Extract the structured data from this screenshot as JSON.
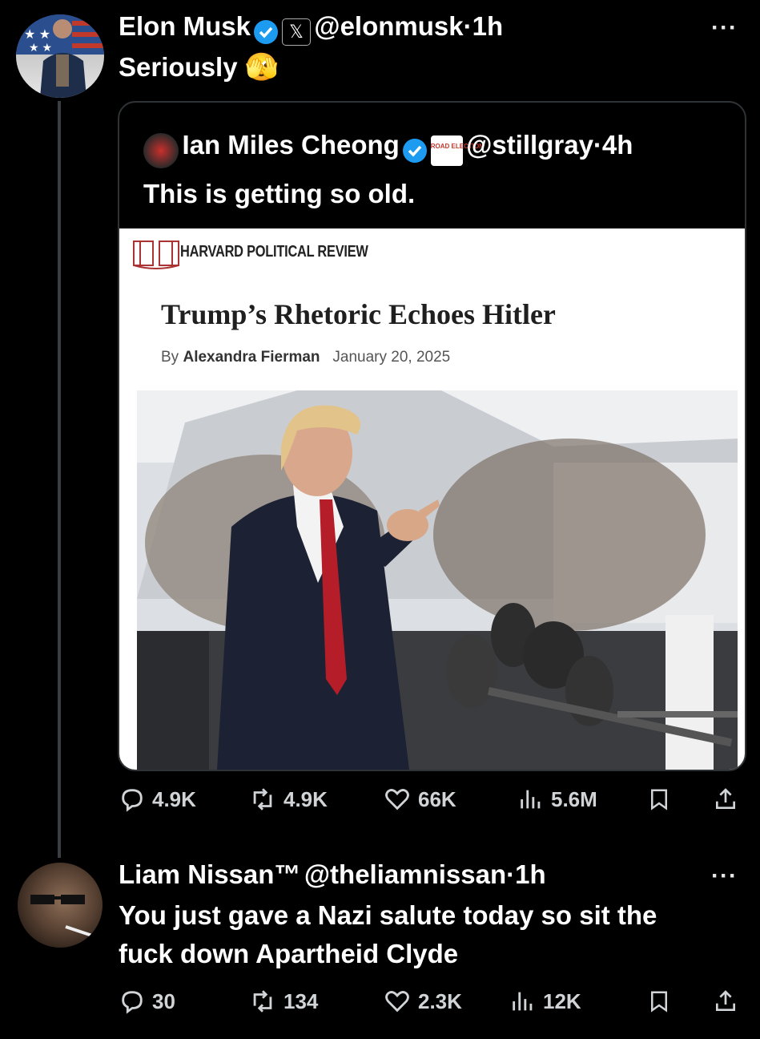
{
  "tweet": {
    "author_name": "Elon Musk",
    "handle": "@elonmusk",
    "time": "1h",
    "text": "Seriously",
    "emoji": "🫣",
    "stats": {
      "replies": "4.9K",
      "reposts": "4.9K",
      "likes": "66K",
      "views": "5.6M"
    }
  },
  "quote": {
    "author_name": "Ian Miles Cheong",
    "handle": "@stillgray",
    "time": "4h",
    "text": "This is getting so old.",
    "badge_text": "ROAD ELECTION",
    "article": {
      "publication": "HARVARD POLITICAL REVIEW",
      "headline": "Trump’s Rhetoric Echoes Hitler",
      "by_prefix": "By",
      "author": "Alexandra Fierman",
      "date": "January 20, 2025"
    }
  },
  "reply": {
    "author_name": "Liam Nissan™",
    "handle": "@theliamnissan",
    "time": "1h",
    "text_line1": "You just gave a Nazi salute today so sit the",
    "text_line2": "fuck down Apartheid Clyde",
    "stats": {
      "replies": "30",
      "reposts": "134",
      "likes": "2.3K",
      "views": "12K"
    }
  },
  "ui": {
    "more": "···",
    "dot": "·",
    "accent": "#1d9bf0"
  }
}
